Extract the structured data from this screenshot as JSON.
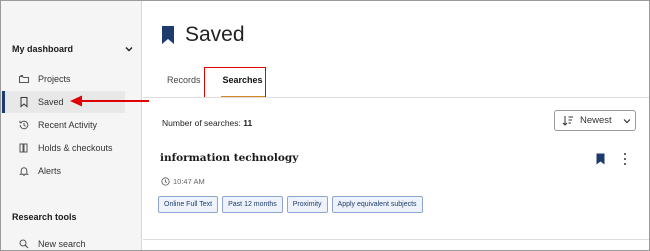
{
  "sidebar": {
    "dashboard_title": "My dashboard",
    "items": [
      {
        "label": "Projects",
        "icon": "folder-icon",
        "active": false
      },
      {
        "label": "Saved",
        "icon": "bookmark-icon",
        "active": true
      },
      {
        "label": "Recent Activity",
        "icon": "history-icon",
        "active": false
      },
      {
        "label": "Holds & checkouts",
        "icon": "books-icon",
        "active": false
      },
      {
        "label": "Alerts",
        "icon": "bell-icon",
        "active": false
      }
    ],
    "research_tools_title": "Research tools",
    "tools": [
      {
        "label": "New search",
        "icon": "search-icon"
      }
    ]
  },
  "main": {
    "title": "Saved",
    "tabs": [
      {
        "label": "Records",
        "selected": false
      },
      {
        "label": "Searches",
        "selected": true
      }
    ],
    "count_label": "Number of searches:",
    "count_value": "11",
    "sort": {
      "label": "Newest"
    },
    "results": [
      {
        "title": "information technology",
        "time": "10:47 AM",
        "filters": [
          "Online Full Text",
          "Past 12 months",
          "Proximity",
          "Apply equivalent subjects"
        ]
      }
    ]
  },
  "colors": {
    "accent": "#1e3b6e",
    "tab_underline": "#d08a1f",
    "annotation": "#e00000",
    "sidebar_bg": "#f5f5f5"
  }
}
